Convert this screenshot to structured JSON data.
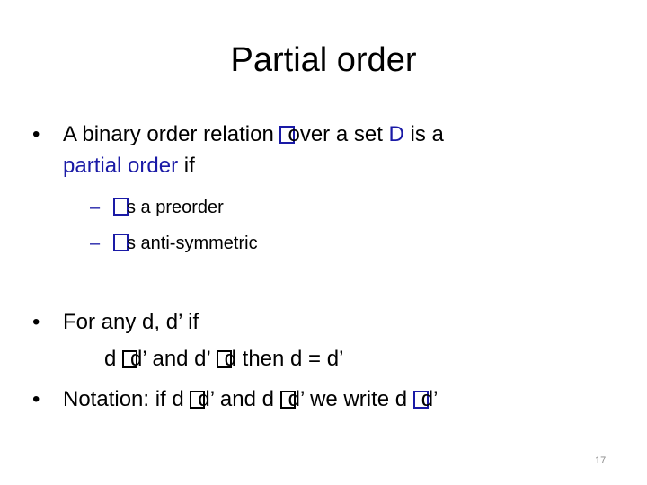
{
  "slide": {
    "title": "Partial order",
    "page_number": "17",
    "colors": {
      "accent": "#1a1aa6",
      "text": "#000000",
      "page_number": "#8a8a8a"
    },
    "bullet_glyph": "•",
    "dash_glyph": "–",
    "missing_glyph_icon": "replacement-box",
    "bullet1": {
      "part1": "A binary order relation ",
      "part2": "over a set ",
      "set_name": "D",
      "part3": " is a",
      "term": "partial order",
      "part4": " if",
      "subitems": [
        {
          "text": "s a preorder"
        },
        {
          "text": "s anti-symmetric"
        }
      ]
    },
    "bullet2": {
      "line1": "For any d, d’ if",
      "l2_a": "d ",
      "l2_b": "d’ and d’ ",
      "l2_c": "d then d = d’"
    },
    "bullet3": {
      "a": "Notation: if d ",
      "b": "d’ and d ",
      "c": "d’ we write d ",
      "d": "d’"
    }
  }
}
